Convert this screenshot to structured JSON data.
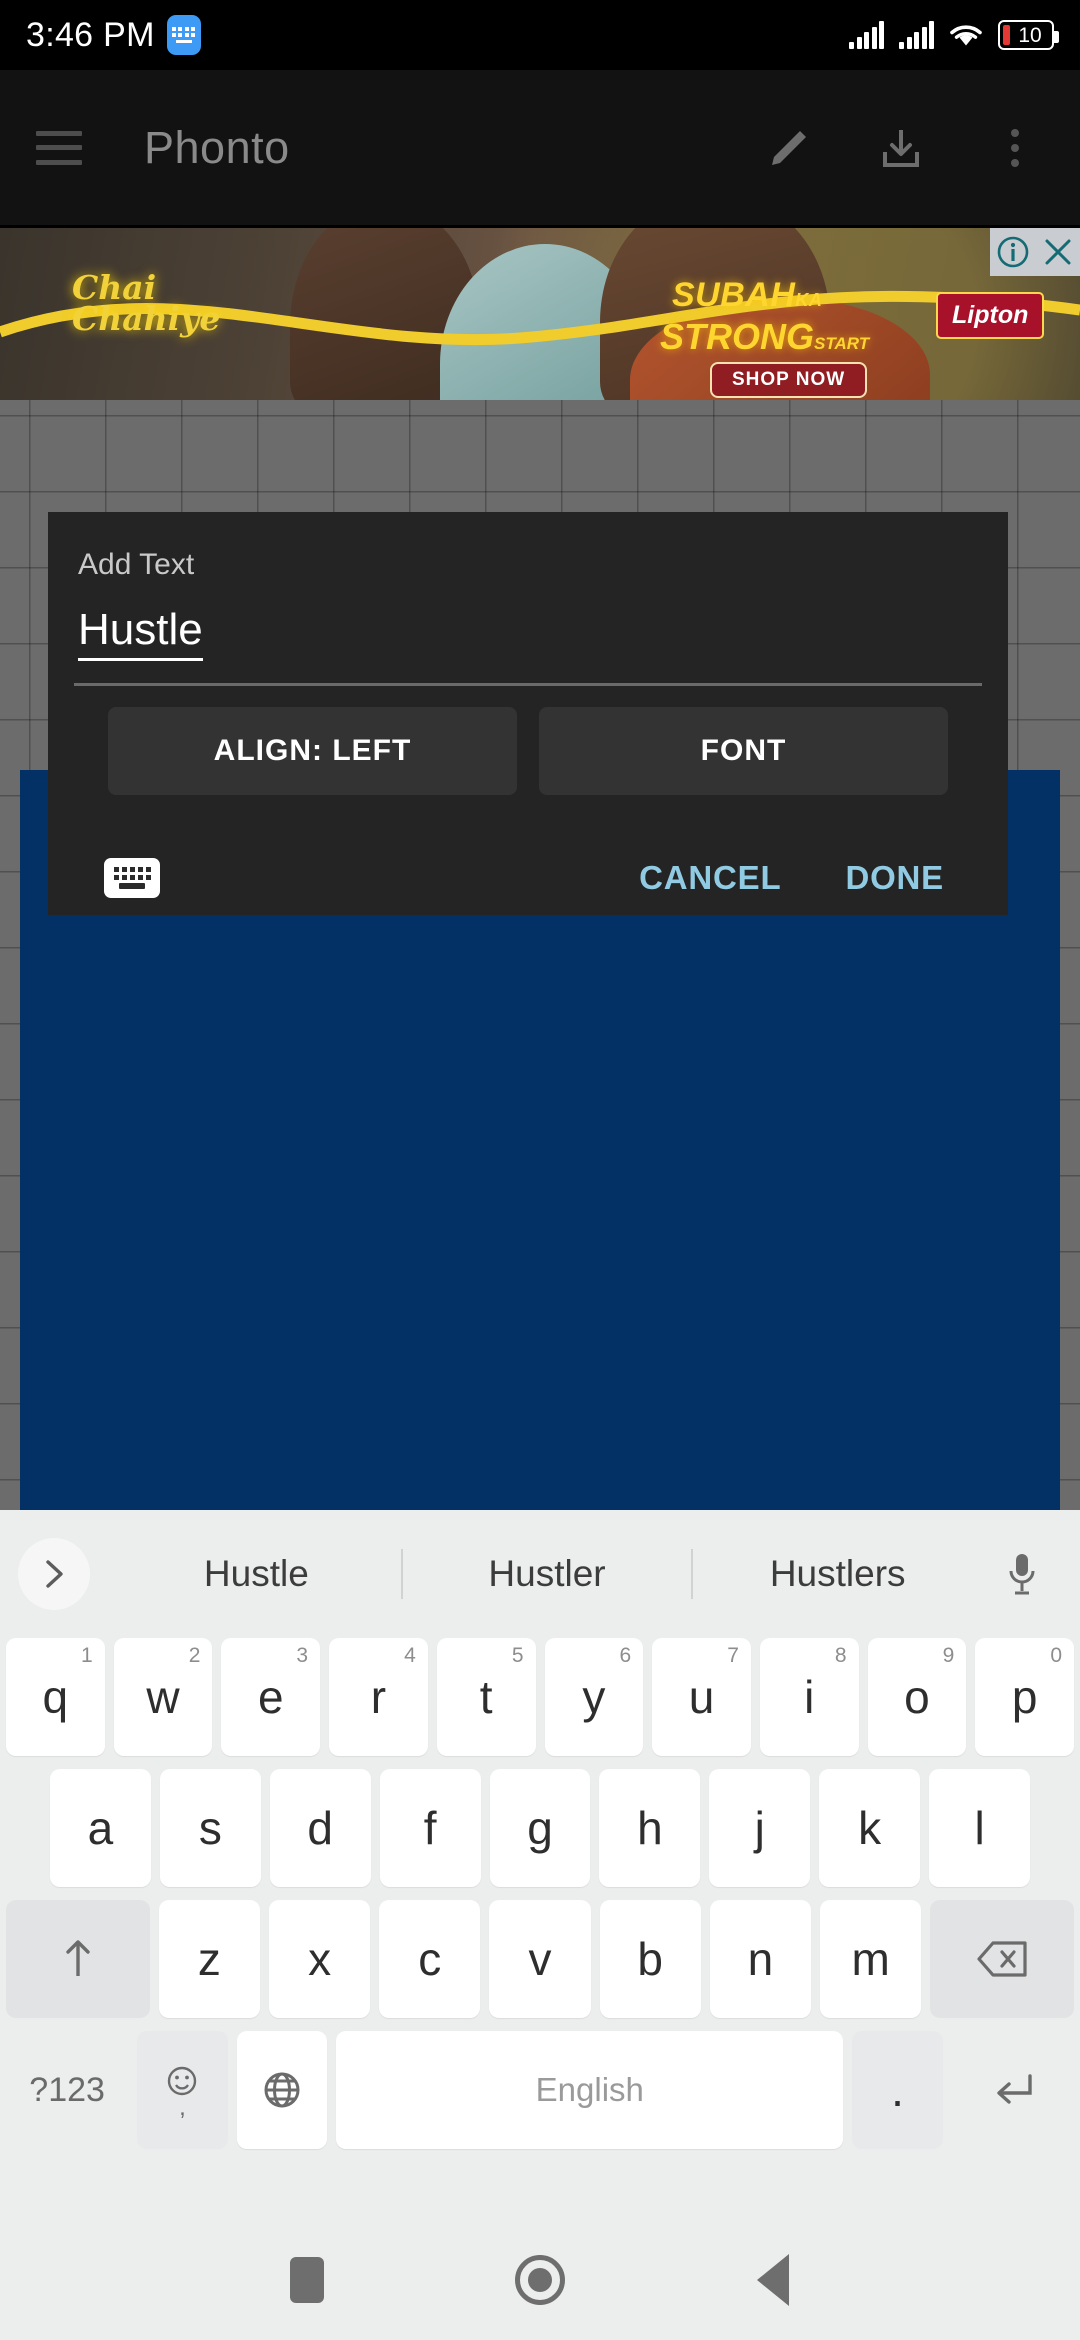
{
  "status_bar": {
    "time": "3:46 PM",
    "keyboard_icon": "keyboard-status-icon",
    "signal_icon": "signal-bars-icon",
    "signal_icon_2": "signal-bars-icon-2",
    "wifi_icon": "wifi-icon",
    "battery_level": "10"
  },
  "app_bar": {
    "menu_icon": "hamburger-menu-icon",
    "title": "Phonto",
    "edit_icon": "pencil-edit-icon",
    "save_icon": "download-save-icon",
    "overflow_icon": "overflow-menu-icon"
  },
  "ad": {
    "headline_1": "Chai",
    "headline_2": "Chahiye",
    "subah": "SUBAH",
    "subah_small": "KA",
    "strong": "STRONG",
    "strong_small": "START",
    "cta": "SHOP NOW",
    "brand": "Lipton",
    "info_icon": "ad-info-icon",
    "close_icon": "ad-close-icon"
  },
  "canvas": {
    "document_color": "#033166",
    "background_color": "#6c6c6c"
  },
  "dialog": {
    "title": "Add Text",
    "input_value": "Hustle",
    "align_button": "ALIGN: LEFT",
    "font_button": "FONT",
    "keyboard_icon": "keyboard-toggle-icon",
    "cancel": "CANCEL",
    "done": "DONE",
    "accent_color": "#90cbe3"
  },
  "keyboard": {
    "expand_icon": "chevron-right-icon",
    "mic_icon": "microphone-icon",
    "suggestions": [
      "Hustle",
      "Hustler",
      "Hustlers"
    ],
    "row1": [
      {
        "key": "q",
        "num": "1"
      },
      {
        "key": "w",
        "num": "2"
      },
      {
        "key": "e",
        "num": "3"
      },
      {
        "key": "r",
        "num": "4"
      },
      {
        "key": "t",
        "num": "5"
      },
      {
        "key": "y",
        "num": "6"
      },
      {
        "key": "u",
        "num": "7"
      },
      {
        "key": "i",
        "num": "8"
      },
      {
        "key": "o",
        "num": "9"
      },
      {
        "key": "p",
        "num": "0"
      }
    ],
    "row2": [
      "a",
      "s",
      "d",
      "f",
      "g",
      "h",
      "j",
      "k",
      "l"
    ],
    "row3": [
      "z",
      "x",
      "c",
      "v",
      "b",
      "n",
      "m"
    ],
    "shift_icon": "shift-arrow-icon",
    "backspace_icon": "backspace-delete-icon",
    "symbols_key": "?123",
    "emoji_icon": "emoji-face-icon",
    "emoji_alt": ",",
    "globe_icon": "language-globe-icon",
    "space_label": "English",
    "period_key": ".",
    "enter_icon": "enter-return-icon"
  },
  "nav_bar": {
    "recents_icon": "recents-square-icon",
    "home_icon": "home-circle-icon",
    "back_icon": "back-triangle-icon"
  }
}
